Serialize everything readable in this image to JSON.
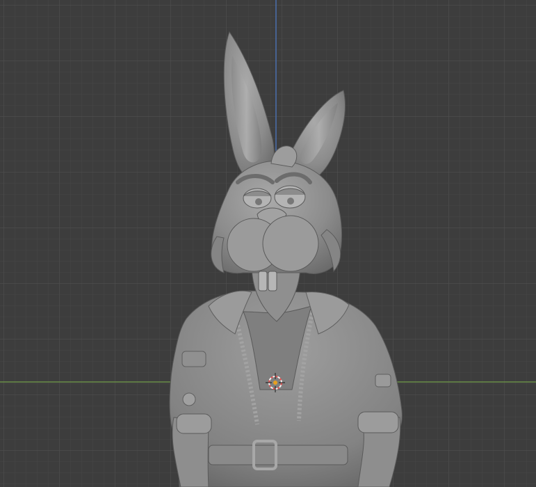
{
  "viewport": {
    "view": "front-orthographic",
    "shading": "solid",
    "grid": true,
    "x_axis_color": "#6a8d47",
    "z_axis_color": "#4a6fae",
    "background_color": "#3d3d3d",
    "grid_color": "#4c4c4c",
    "model_color": "#8e8e8e"
  },
  "model": {
    "subject": "rabbit sculpt"
  },
  "cursor": {
    "icon": "3d-cursor-icon",
    "color": "#e05050"
  }
}
